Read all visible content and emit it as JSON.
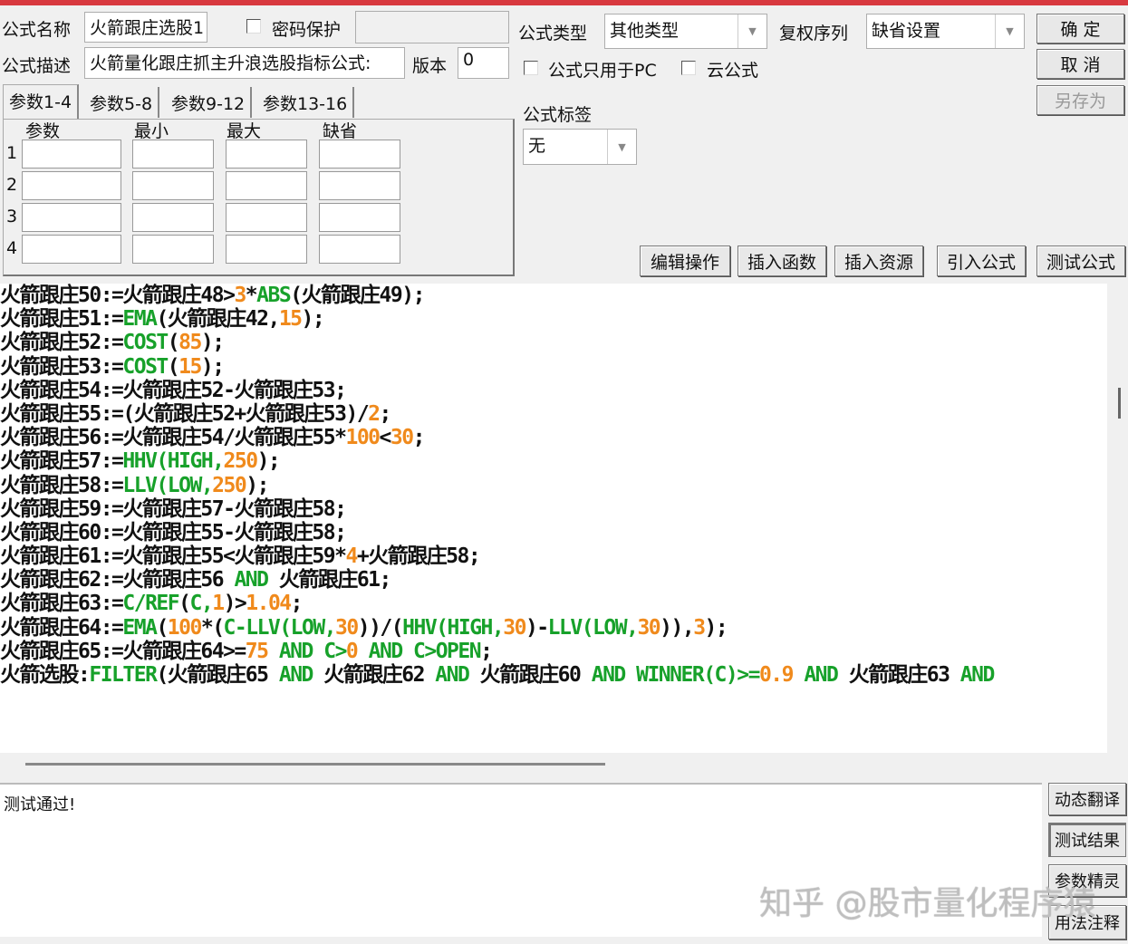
{
  "header": {
    "name_label": "公式名称",
    "name_value": "火箭跟庄选股1",
    "password_label": "密码保护",
    "password_value": "",
    "desc_label": "公式描述",
    "desc_value": "火箭量化跟庄抓主升浪选股指标公式:",
    "version_label": "版本",
    "version_value": "0",
    "type_label": "公式类型",
    "type_value": "其他类型",
    "adjust_label": "复权序列",
    "adjust_value": "缺省设置",
    "pc_only_label": "公式只用于PC",
    "cloud_label": "云公式",
    "tag_label": "公式标签",
    "tag_value": "无"
  },
  "buttons": {
    "ok": "确 定",
    "cancel": "取 消",
    "save_as": "另存为",
    "edit": "编辑操作",
    "insert_func": "插入函数",
    "insert_res": "插入资源",
    "import": "引入公式",
    "test": "测试公式",
    "dynamic": "动态翻译",
    "test_result": "测试结果",
    "param_wizard": "参数精灵",
    "usage": "用法注释"
  },
  "tabs": [
    "参数1-4",
    "参数5-8",
    "参数9-12",
    "参数13-16"
  ],
  "params": {
    "headers": [
      "参数",
      "最小",
      "最大",
      "缺省"
    ],
    "rows": [
      "1",
      "2",
      "3",
      "4"
    ]
  },
  "code": [
    [
      [
        "火箭跟庄50:=火箭跟庄48>",
        "t"
      ],
      [
        "3",
        "n"
      ],
      [
        "*",
        "t"
      ],
      [
        "ABS",
        "k"
      ],
      [
        "(火箭跟庄49);",
        "t"
      ]
    ],
    [
      [
        "火箭跟庄51:=",
        "t"
      ],
      [
        "EMA",
        "k"
      ],
      [
        "(火箭跟庄42,",
        "t"
      ],
      [
        "15",
        "n"
      ],
      [
        ");",
        "t"
      ]
    ],
    [
      [
        "火箭跟庄52:=",
        "t"
      ],
      [
        "COST",
        "k"
      ],
      [
        "(",
        "t"
      ],
      [
        "85",
        "n"
      ],
      [
        ");",
        "t"
      ]
    ],
    [
      [
        "火箭跟庄53:=",
        "t"
      ],
      [
        "COST",
        "k"
      ],
      [
        "(",
        "t"
      ],
      [
        "15",
        "n"
      ],
      [
        ");",
        "t"
      ]
    ],
    [
      [
        "火箭跟庄54:=火箭跟庄52-火箭跟庄53;",
        "t"
      ]
    ],
    [
      [
        "火箭跟庄55:=(火箭跟庄52+火箭跟庄53)/",
        "t"
      ],
      [
        "2",
        "n"
      ],
      [
        ";",
        "t"
      ]
    ],
    [
      [
        "火箭跟庄56:=火箭跟庄54/火箭跟庄55*",
        "t"
      ],
      [
        "100",
        "n"
      ],
      [
        "<",
        "t"
      ],
      [
        "30",
        "n"
      ],
      [
        ";",
        "t"
      ]
    ],
    [
      [
        "火箭跟庄57:=",
        "t"
      ],
      [
        "HHV(HIGH,",
        "k"
      ],
      [
        "250",
        "n"
      ],
      [
        ");",
        "t"
      ]
    ],
    [
      [
        "火箭跟庄58:=",
        "t"
      ],
      [
        "LLV(LOW,",
        "k"
      ],
      [
        "250",
        "n"
      ],
      [
        ");",
        "t"
      ]
    ],
    [
      [
        "火箭跟庄59:=火箭跟庄57-火箭跟庄58;",
        "t"
      ]
    ],
    [
      [
        "火箭跟庄60:=火箭跟庄55-火箭跟庄58;",
        "t"
      ]
    ],
    [
      [
        "火箭跟庄61:=火箭跟庄55<火箭跟庄59*",
        "t"
      ],
      [
        "4",
        "n"
      ],
      [
        "+火箭跟庄58;",
        "t"
      ]
    ],
    [
      [
        "火箭跟庄62:=火箭跟庄56 ",
        "t"
      ],
      [
        "AND",
        "k"
      ],
      [
        " 火箭跟庄61;",
        "t"
      ]
    ],
    [
      [
        "火箭跟庄63:=",
        "t"
      ],
      [
        "C/REF",
        "k"
      ],
      [
        "(",
        "t"
      ],
      [
        "C,",
        "k"
      ],
      [
        "1",
        "n"
      ],
      [
        ")>",
        "t"
      ],
      [
        "1.04",
        "n"
      ],
      [
        ";",
        "t"
      ]
    ],
    [
      [
        "火箭跟庄64:=",
        "t"
      ],
      [
        "EMA",
        "k"
      ],
      [
        "(",
        "t"
      ],
      [
        "100",
        "n"
      ],
      [
        "*(",
        "t"
      ],
      [
        "C-LLV(LOW,",
        "k"
      ],
      [
        "30",
        "n"
      ],
      [
        "))/(",
        "t"
      ],
      [
        "HHV(HIGH,",
        "k"
      ],
      [
        "30",
        "n"
      ],
      [
        ")-",
        "t"
      ],
      [
        "LLV(LOW,",
        "k"
      ],
      [
        "30",
        "n"
      ],
      [
        ")),",
        "t"
      ],
      [
        "3",
        "n"
      ],
      [
        ");",
        "t"
      ]
    ],
    [
      [
        "火箭跟庄65:=火箭跟庄64>=",
        "t"
      ],
      [
        "75",
        "n"
      ],
      [
        " AND C>",
        "k"
      ],
      [
        "0",
        "n"
      ],
      [
        " AND C>OPEN",
        "k"
      ],
      [
        ";",
        "t"
      ]
    ],
    [
      [
        "火箭选股:",
        "t"
      ],
      [
        "FILTER",
        "k"
      ],
      [
        "(火箭跟庄65 ",
        "t"
      ],
      [
        "AND",
        "k"
      ],
      [
        " 火箭跟庄62 ",
        "t"
      ],
      [
        "AND",
        "k"
      ],
      [
        " 火箭跟庄60 ",
        "t"
      ],
      [
        "AND WINNER(C)>=",
        "k"
      ],
      [
        "0.9",
        "n"
      ],
      [
        " AND",
        "k"
      ],
      [
        " 火箭跟庄63 ",
        "t"
      ],
      [
        "AND",
        "k"
      ]
    ]
  ],
  "output": {
    "message": "测试通过!"
  },
  "watermark": "知乎 @股市量化程序猿",
  "colors": {
    "keyword": "#17a12a",
    "number": "#f08a1c",
    "titlebar": "#d8393f"
  }
}
